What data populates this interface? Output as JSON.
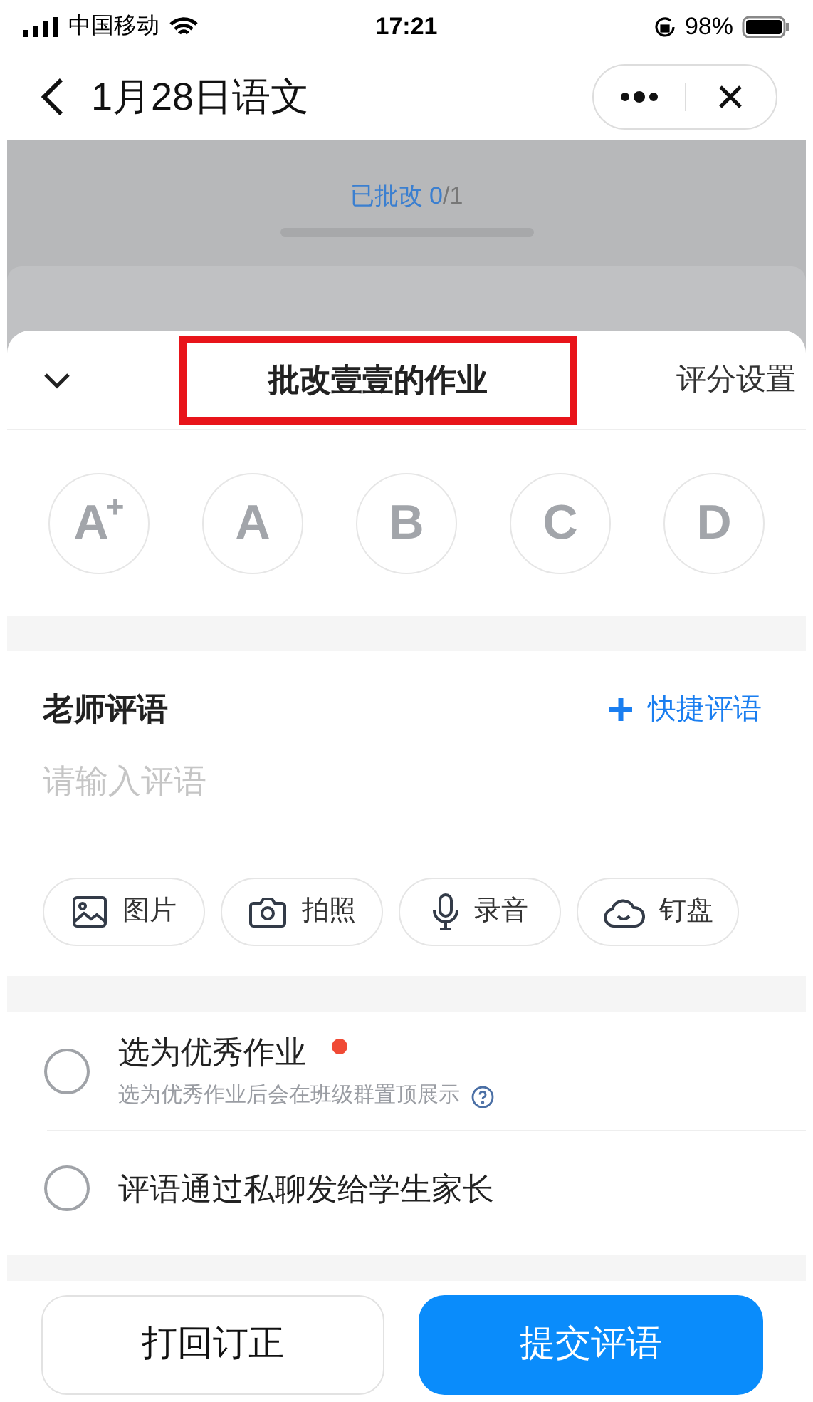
{
  "status_bar": {
    "carrier": "中国移动",
    "time": "17:21",
    "battery": "98%"
  },
  "nav": {
    "title": "1月28日语文"
  },
  "background": {
    "progress_label": "已批改",
    "progress_count": "0",
    "progress_total": "/1"
  },
  "sheet": {
    "title": "批改壹壹的作业",
    "highlighted": true,
    "settings": "评分设置"
  },
  "grades": [
    {
      "letter": "A",
      "sup": "+",
      "selected": false
    },
    {
      "letter": "A",
      "selected": false
    },
    {
      "letter": "B",
      "selected": false
    },
    {
      "letter": "C",
      "selected": false
    },
    {
      "letter": "D",
      "selected": false
    }
  ],
  "comment": {
    "label": "老师评语",
    "quick": "快捷评语",
    "placeholder": "请输入评语"
  },
  "attachments": [
    {
      "kind": "image",
      "label": "图片"
    },
    {
      "kind": "camera",
      "label": "拍照"
    },
    {
      "kind": "mic",
      "label": "录音"
    },
    {
      "kind": "cloud",
      "label": "钉盘"
    }
  ],
  "options": [
    {
      "label": "选为优秀作业",
      "new": true,
      "hint": "选为优秀作业后会在班级群置顶展示",
      "checked": false
    },
    {
      "label": "评语通过私聊发给学生家长",
      "new": false,
      "checked": false
    }
  ],
  "buttons": {
    "secondary": "打回订正",
    "primary": "提交评语"
  }
}
